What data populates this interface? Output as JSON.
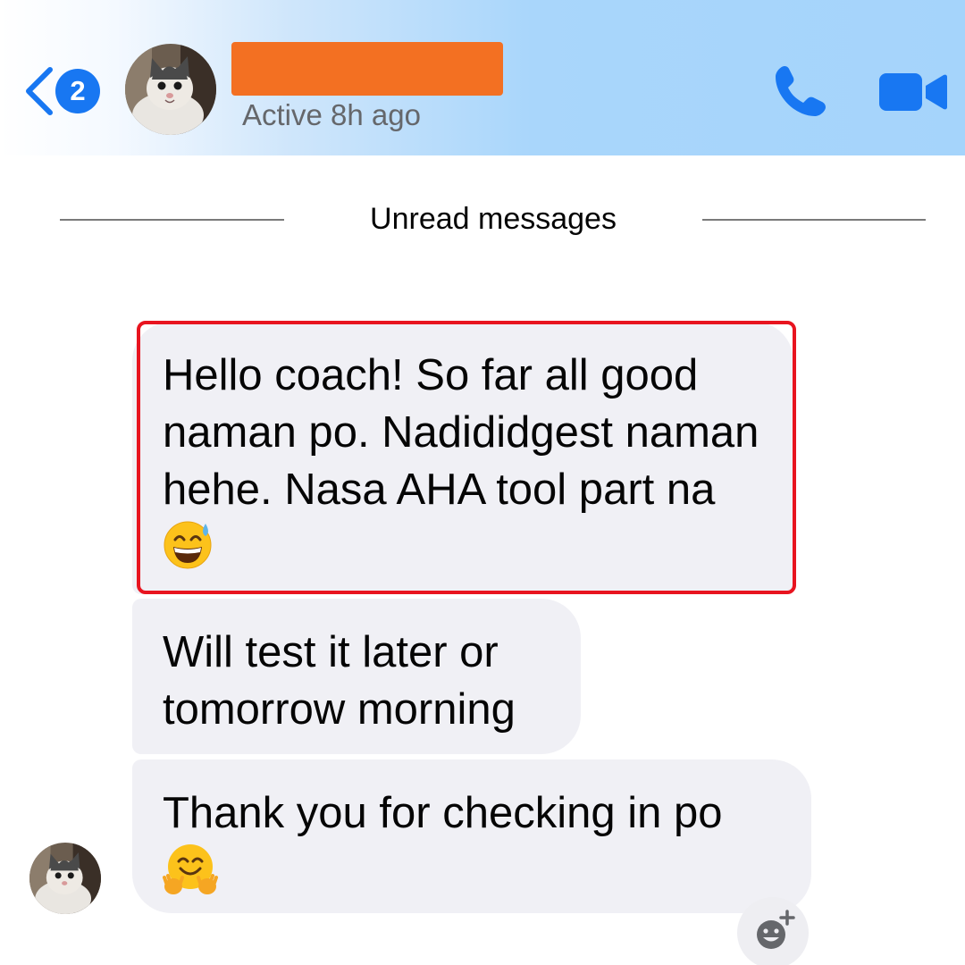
{
  "header": {
    "unread_count": "2",
    "contact_presence": "Active 8h ago",
    "redaction_color": "#f37022",
    "accent_color": "#1877f2",
    "icons": {
      "back": "chevron-left-icon",
      "call": "phone-icon",
      "video": "video-camera-icon"
    }
  },
  "divider": {
    "label": "Unread messages"
  },
  "messages": [
    {
      "text": "Hello coach! So far all good naman po. Nadididgest naman hehe. Nasa AHA tool part na",
      "emoji": "grinning-face-with-sweat-emoji",
      "highlighted": true,
      "highlight_color": "#e8141f"
    },
    {
      "text": "Will test it later or tomorrow morning"
    },
    {
      "text": "Thank you for checking in po",
      "emoji": "hugging-face-emoji"
    }
  ],
  "reaction": {
    "icon": "add-reaction-icon"
  }
}
